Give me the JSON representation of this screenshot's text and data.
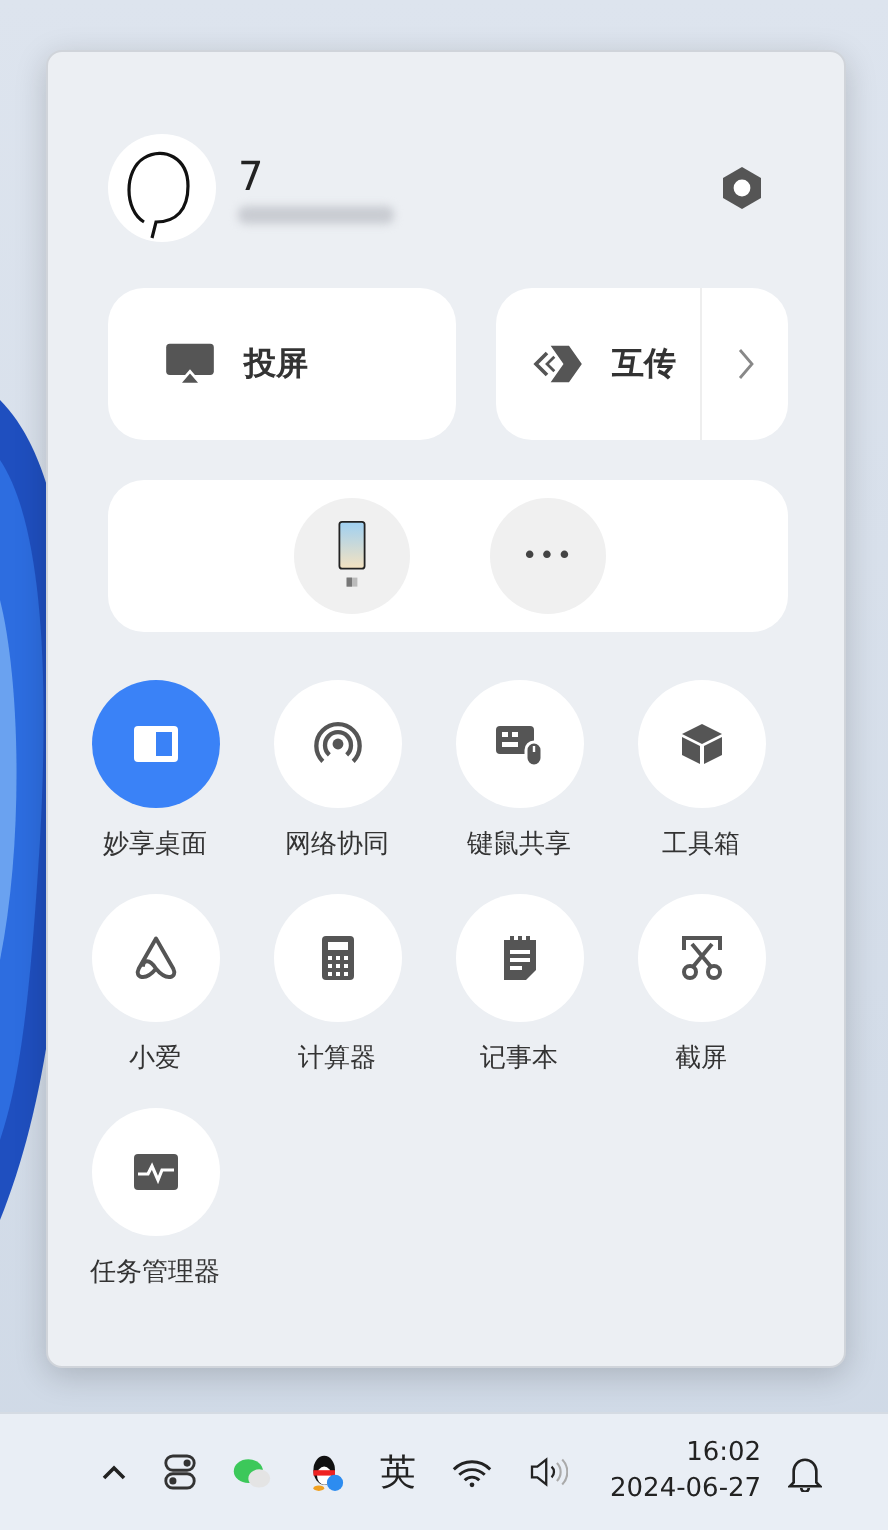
{
  "profile": {
    "name": "7"
  },
  "quick_buttons": [
    {
      "kind": "cast",
      "label": "投屏"
    },
    {
      "kind": "transfer",
      "label": "互传"
    }
  ],
  "devices": [
    {
      "kind": "phone"
    },
    {
      "kind": "more",
      "label": "•••"
    }
  ],
  "tiles": [
    {
      "kind": "desktop",
      "label": "妙享桌面",
      "on": true
    },
    {
      "kind": "network",
      "label": "网络协同",
      "on": false
    },
    {
      "kind": "keymouse",
      "label": "键鼠共享",
      "on": false
    },
    {
      "kind": "toolbox",
      "label": "工具箱",
      "on": false
    },
    {
      "kind": "assistant",
      "label": "小爱",
      "on": false
    },
    {
      "kind": "calculator",
      "label": "计算器",
      "on": false
    },
    {
      "kind": "notepad",
      "label": "记事本",
      "on": false
    },
    {
      "kind": "screenshot",
      "label": "截屏",
      "on": false
    },
    {
      "kind": "taskmgr",
      "label": "任务管理器",
      "on": false
    }
  ],
  "taskbar": {
    "tray": [
      {
        "kind": "chevron"
      },
      {
        "kind": "toggle"
      },
      {
        "kind": "chat"
      },
      {
        "kind": "penguin"
      },
      {
        "kind": "ime",
        "label": "英"
      },
      {
        "kind": "wifi"
      },
      {
        "kind": "volume"
      }
    ],
    "time": "16:02",
    "date": "2024-06-27"
  }
}
